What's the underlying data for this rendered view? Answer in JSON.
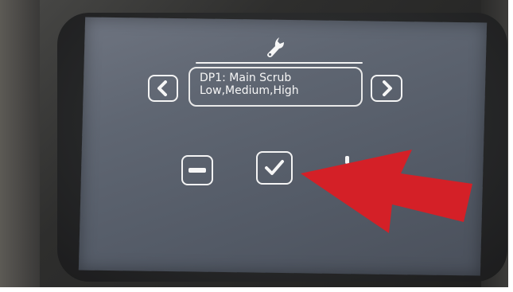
{
  "screen": {
    "header_icon": "wrench-icon",
    "parameter": {
      "title": "DP1: Main Scrub",
      "options": "Low,Medium,High"
    },
    "nav": {
      "prev_icon": "chevron-left-icon",
      "next_icon": "chevron-right-icon"
    },
    "controls": {
      "decrease_icon": "minus-icon",
      "confirm_icon": "checkmark-icon",
      "increase_icon": "plus-icon"
    }
  },
  "overlay": {
    "annotation_arrow_color": "#d42027"
  },
  "colors": {
    "screen": "#5f6672",
    "ui_white": "#f4f4f4",
    "bezel": "#262728"
  }
}
